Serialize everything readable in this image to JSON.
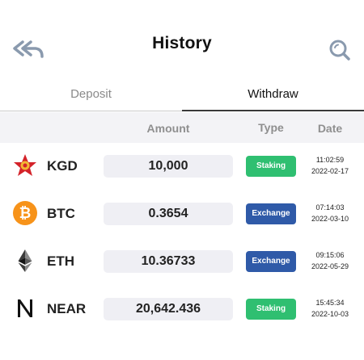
{
  "header": {
    "title": "History",
    "back_icon": "double-back-arrow-icon",
    "search_icon": "search-icon"
  },
  "tabs": [
    {
      "label": "Deposit",
      "active": false
    },
    {
      "label": "Withdraw",
      "active": true
    }
  ],
  "table": {
    "columns": {
      "amount": "Amount",
      "type": "Type",
      "date": "Date"
    },
    "rows": [
      {
        "symbol": "KGD",
        "icon": "kgd-logo-icon",
        "amount": "10,000",
        "type": "Staking",
        "time": "11:02:59",
        "date": "2022-02-17"
      },
      {
        "symbol": "BTC",
        "icon": "bitcoin-logo-icon",
        "amount": "0.3654",
        "type": "Exchange",
        "time": "07:14:03",
        "date": "2022-03-10"
      },
      {
        "symbol": "ETH",
        "icon": "ethereum-logo-icon",
        "amount": "10.36733",
        "type": "Exchange",
        "time": "09:15:06",
        "date": "2022-05-29"
      },
      {
        "symbol": "NEAR",
        "icon": "near-logo-icon",
        "amount": "20,642.436",
        "type": "Staking",
        "time": "15:45:34",
        "date": "2022-10-03"
      }
    ]
  },
  "colors": {
    "staking": "#2fbf71",
    "exchange": "#2f5aa8",
    "bitcoin": "#f7931a",
    "kgd": "#d4232a"
  }
}
